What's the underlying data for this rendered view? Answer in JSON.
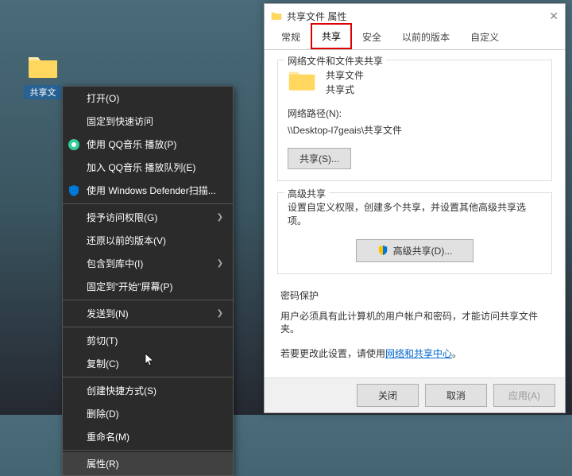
{
  "desktop": {
    "folder_label": "共享文"
  },
  "context_menu": {
    "items": [
      {
        "label": "打开(O)",
        "icon": null,
        "arrow": false
      },
      {
        "label": "固定到快速访问",
        "icon": null,
        "arrow": false
      },
      {
        "label": "使用 QQ音乐 播放(P)",
        "icon": "qq",
        "arrow": false
      },
      {
        "label": "加入 QQ音乐 播放队列(E)",
        "icon": null,
        "arrow": false
      },
      {
        "label": "使用 Windows Defender扫描...",
        "icon": "shield",
        "arrow": false
      }
    ],
    "group2": [
      {
        "label": "授予访问权限(G)",
        "arrow": true
      },
      {
        "label": "还原以前的版本(V)",
        "arrow": false
      },
      {
        "label": "包含到库中(I)",
        "arrow": true
      },
      {
        "label": "固定到\"开始\"屏幕(P)",
        "arrow": false
      }
    ],
    "group3": [
      {
        "label": "发送到(N)",
        "arrow": true
      }
    ],
    "group4": [
      {
        "label": "剪切(T)",
        "arrow": false
      },
      {
        "label": "复制(C)",
        "arrow": false
      }
    ],
    "group5": [
      {
        "label": "创建快捷方式(S)",
        "arrow": false
      },
      {
        "label": "删除(D)",
        "arrow": false
      },
      {
        "label": "重命名(M)",
        "arrow": false
      }
    ],
    "group6": [
      {
        "label": "属性(R)",
        "arrow": false
      }
    ]
  },
  "dialog": {
    "title": "共享文件 属性",
    "tabs": {
      "general": "常规",
      "share": "共享",
      "security": "安全",
      "previous": "以前的版本",
      "custom": "自定义"
    },
    "section1": {
      "title": "网络文件和文件夹共享",
      "folder_name": "共享文件",
      "share_status": "共享式",
      "path_label": "网络路径(N):",
      "path_value": "\\\\Desktop-l7geais\\共享文件",
      "share_btn": "共享(S)..."
    },
    "section2": {
      "title": "高级共享",
      "desc": "设置自定义权限，创建多个共享，并设置其他高级共享选项。",
      "btn": "高级共享(D)..."
    },
    "section3": {
      "title": "密码保护",
      "line1": "用户必须具有此计算机的用户帐户和密码，才能访问共享文件夹。",
      "line2_a": "若要更改此设置，请使用",
      "line2_link": "网络和共享中心",
      "line2_b": "。"
    },
    "buttons": {
      "ok": "关闭",
      "cancel": "取消",
      "apply": "应用(A)"
    }
  }
}
